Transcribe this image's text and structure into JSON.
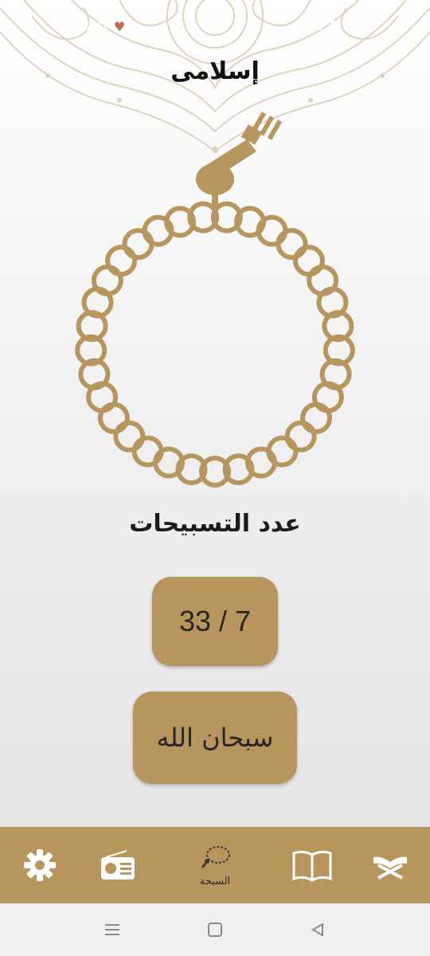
{
  "app": {
    "title": "إسلامى"
  },
  "status": {
    "left_text": "06",
    "right_text": ""
  },
  "main": {
    "count_title": "عدد التسبيحات",
    "counter": {
      "current": "7",
      "total": "33",
      "display": "33 / 7"
    },
    "zikr_label": "سبحان الله"
  },
  "nav": {
    "items": [
      {
        "icon": "gear-icon",
        "label": ""
      },
      {
        "icon": "radio-icon",
        "label": ""
      },
      {
        "icon": "rosary-icon",
        "label": "السبحة",
        "active": true
      },
      {
        "icon": "open-book-icon",
        "label": ""
      },
      {
        "icon": "quran-stand-icon",
        "label": ""
      }
    ]
  },
  "colors": {
    "accent": "#b8955d",
    "ink": "#1c1c1c",
    "mandala": "#e3d7c3"
  }
}
